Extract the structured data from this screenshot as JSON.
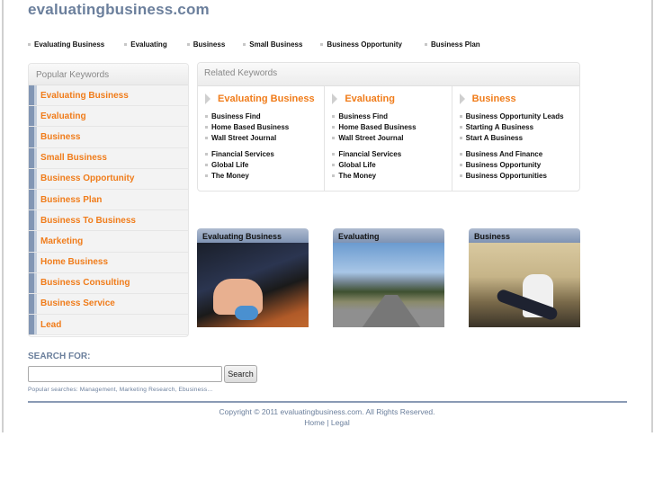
{
  "site": {
    "title": "evaluatingbusiness.com"
  },
  "topnav": [
    "Evaluating Business",
    "Evaluating",
    "Business",
    "Small Business",
    "Business Opportunity",
    "Business Plan"
  ],
  "sidebar": {
    "heading": "Popular Keywords",
    "items": [
      "Evaluating Business",
      "Evaluating",
      "Business",
      "Small Business",
      "Business Opportunity",
      "Business Plan",
      "Business To Business",
      "Marketing",
      "Home Business",
      "Business Consulting",
      "Business Service",
      "Lead"
    ]
  },
  "related": {
    "heading": "Related Keywords",
    "columns": [
      {
        "title": "Evaluating Business",
        "group1": [
          "Business Find",
          "Home Based Business",
          "Wall Street Journal"
        ],
        "group2": [
          "Financial Services",
          "Global Life",
          "The Money"
        ]
      },
      {
        "title": "Evaluating",
        "group1": [
          "Business Find",
          "Home Based Business",
          "Wall Street Journal"
        ],
        "group2": [
          "Financial Services",
          "Global Life",
          "The Money"
        ]
      },
      {
        "title": "Business",
        "group1": [
          "Business Opportunity Leads",
          "Starting A Business",
          "Start A Business"
        ],
        "group2": [
          "Business And Finance",
          "Business Opportunity",
          "Business Opportunities"
        ]
      }
    ]
  },
  "thumbs": [
    {
      "title": "Evaluating Business"
    },
    {
      "title": "Evaluating"
    },
    {
      "title": "Business"
    }
  ],
  "search": {
    "label": "SEARCH FOR:",
    "value": "",
    "button": "Search",
    "popular": "Popular searches: Management, Marketing Research, Ebusiness..."
  },
  "footer": {
    "copyright": "Copyright © 2011 evaluatingbusiness.com. All Rights Reserved.",
    "home": "Home",
    "separator": " | ",
    "legal": "Legal"
  },
  "colors": {
    "accent": "#f07c1a",
    "brand": "#6b7f9c",
    "sidebar_bar": "#8296b4"
  }
}
